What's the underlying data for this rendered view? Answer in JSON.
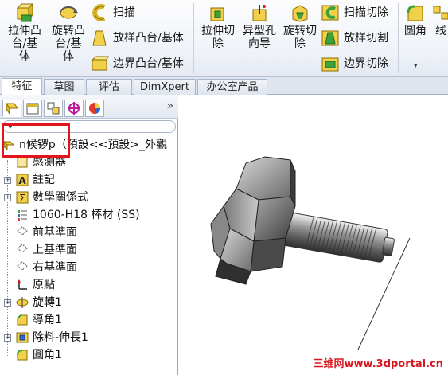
{
  "ribbon": {
    "buttons": [
      {
        "label_lines": [
          "拉伸凸",
          "台/基",
          "体"
        ],
        "icon": "extrude-boss-icon"
      },
      {
        "label_lines": [
          "旋转凸",
          "台/基",
          "体"
        ],
        "icon": "revolve-boss-icon"
      },
      {
        "label_lines": [
          "拉伸切",
          "除"
        ],
        "icon": "extrude-cut-icon"
      },
      {
        "label_lines": [
          "异型孔",
          "向导"
        ],
        "icon": "hole-wizard-icon"
      },
      {
        "label_lines": [
          "旋转切",
          "除"
        ],
        "icon": "revolve-cut-icon"
      },
      {
        "label_lines": [
          "圆角"
        ],
        "icon": "fillet-icon"
      },
      {
        "label_lines": [
          "线"
        ],
        "icon": "linear-pattern-icon"
      }
    ],
    "small_buttons": [
      {
        "label": "扫描",
        "icon": "sweep-icon"
      },
      {
        "label": "放样凸台/基体",
        "icon": "loft-icon"
      },
      {
        "label": "边界凸台/基体",
        "icon": "boundary-boss-icon"
      },
      {
        "label": "扫描切除",
        "icon": "swept-cut-icon"
      },
      {
        "label": "放样切割",
        "icon": "lofted-cut-icon"
      },
      {
        "label": "边界切除",
        "icon": "boundary-cut-icon"
      }
    ]
  },
  "tabs": [
    "特征",
    "草图",
    "评估",
    "DimXpert",
    "办公室产品"
  ],
  "tree": {
    "root": "n候锣p（預設<<預設>_外觀",
    "items": [
      {
        "label": "感測器",
        "icon": "sensor-icon"
      },
      {
        "label": "註記",
        "icon": "annotation-icon"
      },
      {
        "label": "數學關係式",
        "icon": "equation-icon"
      },
      {
        "label": "1060-H18 棒材 (SS)",
        "icon": "material-icon"
      },
      {
        "label": "前基準面",
        "icon": "plane-icon"
      },
      {
        "label": "上基準面",
        "icon": "plane-icon"
      },
      {
        "label": "右基準面",
        "icon": "plane-icon"
      },
      {
        "label": "原點",
        "icon": "origin-icon"
      },
      {
        "label": "旋轉1",
        "icon": "revolve-feature-icon"
      },
      {
        "label": "導角1",
        "icon": "chamfer-icon"
      },
      {
        "label": "除料-伸長1",
        "icon": "cut-extrude-icon"
      },
      {
        "label": "圓角1",
        "icon": "fillet-feature-icon"
      }
    ]
  },
  "panel": {
    "more": "»"
  },
  "watermark": "三维网www.3dportal.cn"
}
